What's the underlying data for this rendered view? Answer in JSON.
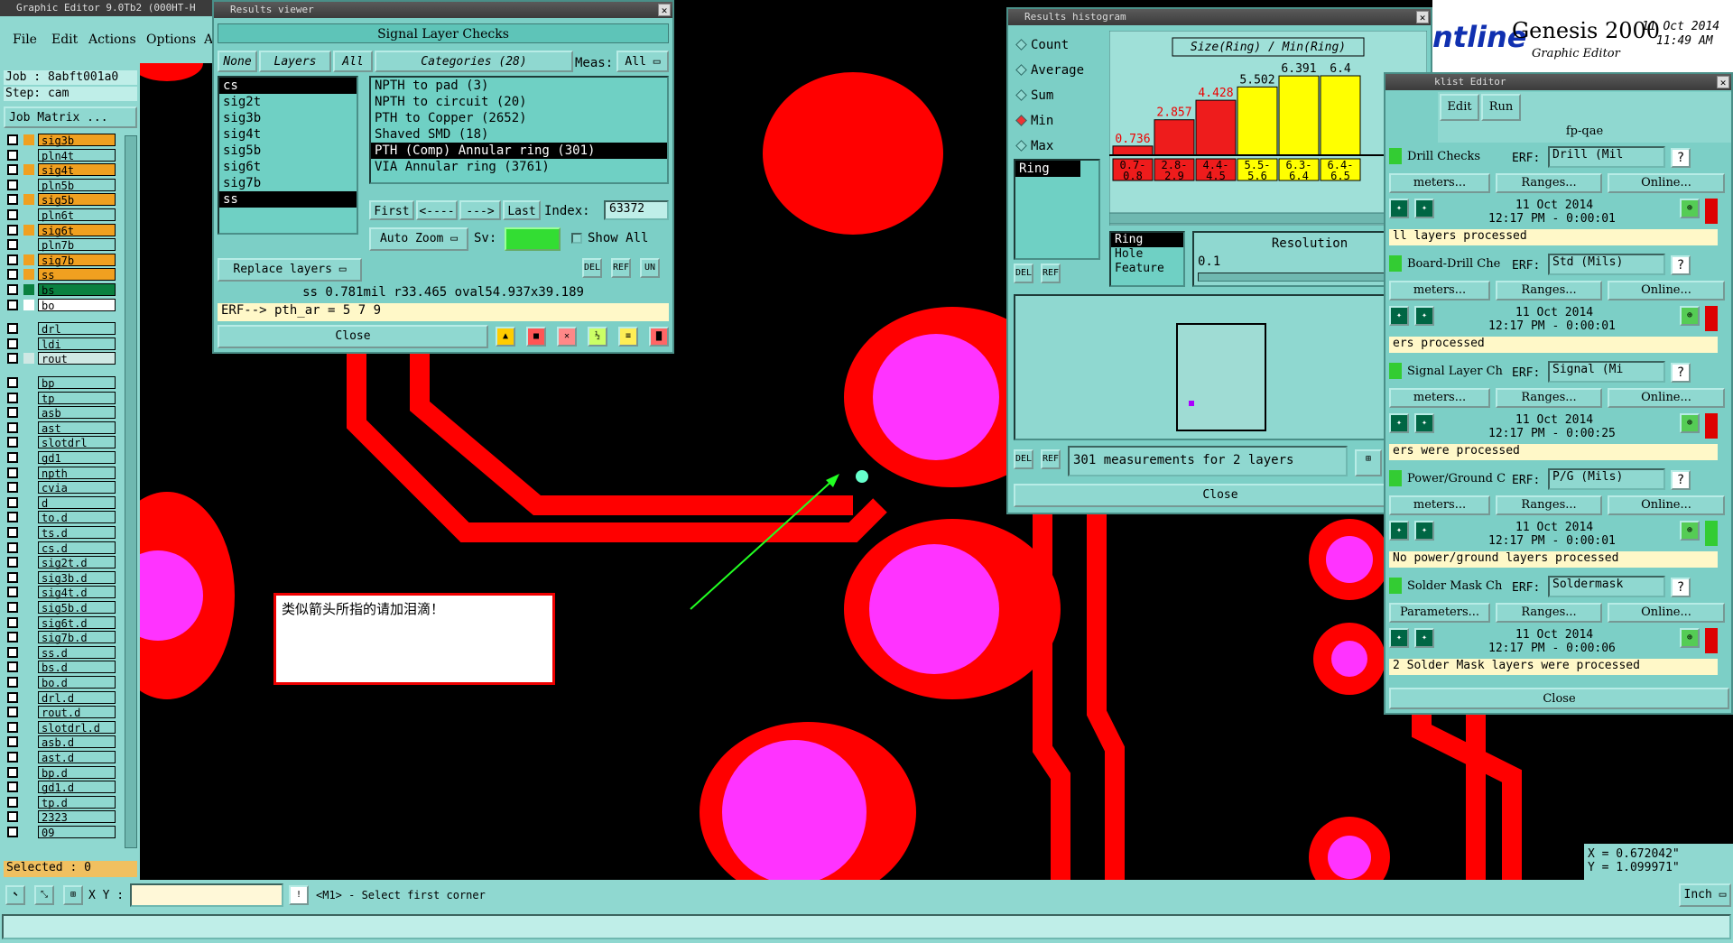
{
  "app": {
    "window_title": "Graphic Editor 9.0Tb2 (000HT-H",
    "menu": [
      "File",
      "Edit",
      "Actions",
      "Options",
      "A"
    ],
    "job_label": "Job : 8abft001a0",
    "step_label": "Step: cam",
    "job_matrix_button": "Job Matrix ...",
    "selected_label": "Selected : 0",
    "brand": "Genesis 2000",
    "brand_sub": "Graphic Editor",
    "brand_logo": "ntline",
    "date": "11 Oct 2014",
    "time": "11:49 AM"
  },
  "layers": [
    {
      "name": "sig3b",
      "color": "#f0a020"
    },
    {
      "name": "pln4t",
      "color": "#8fd8d0"
    },
    {
      "name": "sig4t",
      "color": "#f0a020"
    },
    {
      "name": "pln5b",
      "color": "#8fd8d0"
    },
    {
      "name": "sig5b",
      "color": "#f0a020"
    },
    {
      "name": "pln6t",
      "color": "#8fd8d0"
    },
    {
      "name": "sig6t",
      "color": "#f0a020"
    },
    {
      "name": "pln7b",
      "color": "#8fd8d0"
    },
    {
      "name": "sig7b",
      "color": "#f0a020"
    },
    {
      "name": "ss",
      "color": "#f0a020"
    },
    {
      "name": "bs",
      "color": "#0a8040"
    },
    {
      "name": "bo",
      "color": "#ffffff"
    },
    {
      "name": "drl",
      "color": "#8fd8d0"
    },
    {
      "name": "ldi",
      "color": "#8fd8d0"
    },
    {
      "name": "rout",
      "color": "#cfe8e4"
    },
    {
      "name": "bp",
      "color": "#8fd8d0"
    },
    {
      "name": "tp",
      "color": "#8fd8d0"
    },
    {
      "name": "asb",
      "color": "#8fd8d0"
    },
    {
      "name": "ast",
      "color": "#8fd8d0"
    },
    {
      "name": "slotdrl",
      "color": "#8fd8d0"
    },
    {
      "name": "gd1",
      "color": "#8fd8d0"
    },
    {
      "name": "npth",
      "color": "#8fd8d0"
    },
    {
      "name": "cvia",
      "color": "#8fd8d0"
    },
    {
      "name": "d",
      "color": "#8fd8d0"
    },
    {
      "name": "to.d",
      "color": "#8fd8d0"
    },
    {
      "name": "ts.d",
      "color": "#8fd8d0"
    },
    {
      "name": "cs.d",
      "color": "#8fd8d0"
    },
    {
      "name": "sig2t.d",
      "color": "#8fd8d0"
    },
    {
      "name": "sig3b.d",
      "color": "#8fd8d0"
    },
    {
      "name": "sig4t.d",
      "color": "#8fd8d0"
    },
    {
      "name": "sig5b.d",
      "color": "#8fd8d0"
    },
    {
      "name": "sig6t.d",
      "color": "#8fd8d0"
    },
    {
      "name": "sig7b.d",
      "color": "#8fd8d0"
    },
    {
      "name": "ss.d",
      "color": "#8fd8d0"
    },
    {
      "name": "bs.d",
      "color": "#8fd8d0"
    },
    {
      "name": "bo.d",
      "color": "#8fd8d0"
    },
    {
      "name": "drl.d",
      "color": "#8fd8d0"
    },
    {
      "name": "rout.d",
      "color": "#8fd8d0"
    },
    {
      "name": "slotdrl.d",
      "color": "#8fd8d0"
    },
    {
      "name": "asb.d",
      "color": "#8fd8d0"
    },
    {
      "name": "ast.d",
      "color": "#8fd8d0"
    },
    {
      "name": "bp.d",
      "color": "#8fd8d0"
    },
    {
      "name": "gd1.d",
      "color": "#8fd8d0"
    },
    {
      "name": "tp.d",
      "color": "#8fd8d0"
    },
    {
      "name": "2323",
      "color": "#8fd8d0"
    },
    {
      "name": "09",
      "color": "#8fd8d0"
    }
  ],
  "results_viewer": {
    "title": "Results viewer",
    "heading": "Signal Layer Checks",
    "none_btn": "None",
    "layers_btn": "Layers",
    "all_btn": "All",
    "categories_btn": "Categories (28)",
    "meas_label": "Meas:",
    "meas_value": "All",
    "layer_list": [
      "cs",
      "sig2t",
      "sig3b",
      "sig4t",
      "sig5b",
      "sig6t",
      "sig7b",
      "ss"
    ],
    "categories": [
      "NPTH to pad (3)",
      "NPTH to circuit (20)",
      "PTH to Copper (2652)",
      "Shaved SMD (18)",
      "PTH (Comp) Annular ring (301)",
      "VIA Annular ring (3761)"
    ],
    "first_btn": "First",
    "prev_btn": "<----",
    "next_btn": "--->",
    "last_btn": "Last",
    "index_label": "Index:",
    "index_value": "63372",
    "auto_zoom": "Auto Zoom",
    "sv_label": "Sv:",
    "show_all": "Show All",
    "replace_layers": "Replace layers",
    "status_line": "ss 0.781mil  r33.465  oval54.937x39.189",
    "erf_line": "ERF--> pth_ar = 5 7 9",
    "close": "Close"
  },
  "histogram": {
    "title": "Results histogram",
    "options": [
      "Count",
      "Average",
      "Sum",
      "Min",
      "Max"
    ],
    "selected_option": "Min",
    "chart_title": "Size(Ring) / Min(Ring)",
    "list_items": [
      "Ring"
    ],
    "type_items": [
      "Ring",
      "Hole",
      "Feature"
    ],
    "resolution_label": "Resolution",
    "resolution_value": "0.1",
    "measurements": "301 measurements for 2 layers",
    "close": "Close"
  },
  "chart_data": {
    "type": "bar",
    "title": "Size(Ring) / Min(Ring)",
    "categories": [
      "0.7-0.8",
      "2.8-2.9",
      "4.4-4.5",
      "5.5-5.6",
      "6.3-6.4",
      "6.4-6.5"
    ],
    "values": [
      0.736,
      2.857,
      4.428,
      5.502,
      6.391,
      6.4
    ],
    "colors": [
      "#ee1c1c",
      "#ee1c1c",
      "#ee1c1c",
      "#ffff00",
      "#ffff00",
      "#ffff00"
    ]
  },
  "checklist": {
    "title": "klist Editor",
    "menu": [
      "Edit",
      "Run"
    ],
    "name": "fp-qae",
    "items": [
      {
        "name": "Drill Checks",
        "erf": "Drill (Mil",
        "date": "11 Oct 2014",
        "time": "12:17 PM - 0:00:01",
        "msg": "ll layers processed"
      },
      {
        "name": "Board-Drill Che",
        "erf": "Std (Mils)",
        "date": "11 Oct 2014",
        "time": "12:17 PM - 0:00:01",
        "msg": "ers processed"
      },
      {
        "name": "Signal Layer Ch",
        "erf": "Signal (Mi",
        "date": "11 Oct 2014",
        "time": "12:17 PM - 0:00:25",
        "msg": "ers were processed"
      },
      {
        "name": "Power/Ground C",
        "erf": "P/G (Mils)",
        "date": "11 Oct 2014",
        "time": "12:17 PM - 0:00:01",
        "msg": "No power/ground layers processed"
      },
      {
        "name": "Solder Mask Ch",
        "erf": "Soldermask",
        "date": "11 Oct 2014",
        "time": "12:17 PM - 0:00:06",
        "msg": "2 Solder Mask layers were processed"
      }
    ],
    "erf_label": "ERF:",
    "params_btn": "Parameters...",
    "params_btn_cut": "meters...",
    "ranges_btn": "Ranges...",
    "online_btn": "Online...",
    "close": "Close"
  },
  "annotation": {
    "text": "类似箭头所指的请加泪滴！"
  },
  "coords": {
    "x": "X = 0.672042\"",
    "y": "Y = 1.099971\""
  },
  "statusbar": {
    "xy_label": "X Y :",
    "prompt": "<M1> - Select first corner",
    "units": "Inch"
  }
}
